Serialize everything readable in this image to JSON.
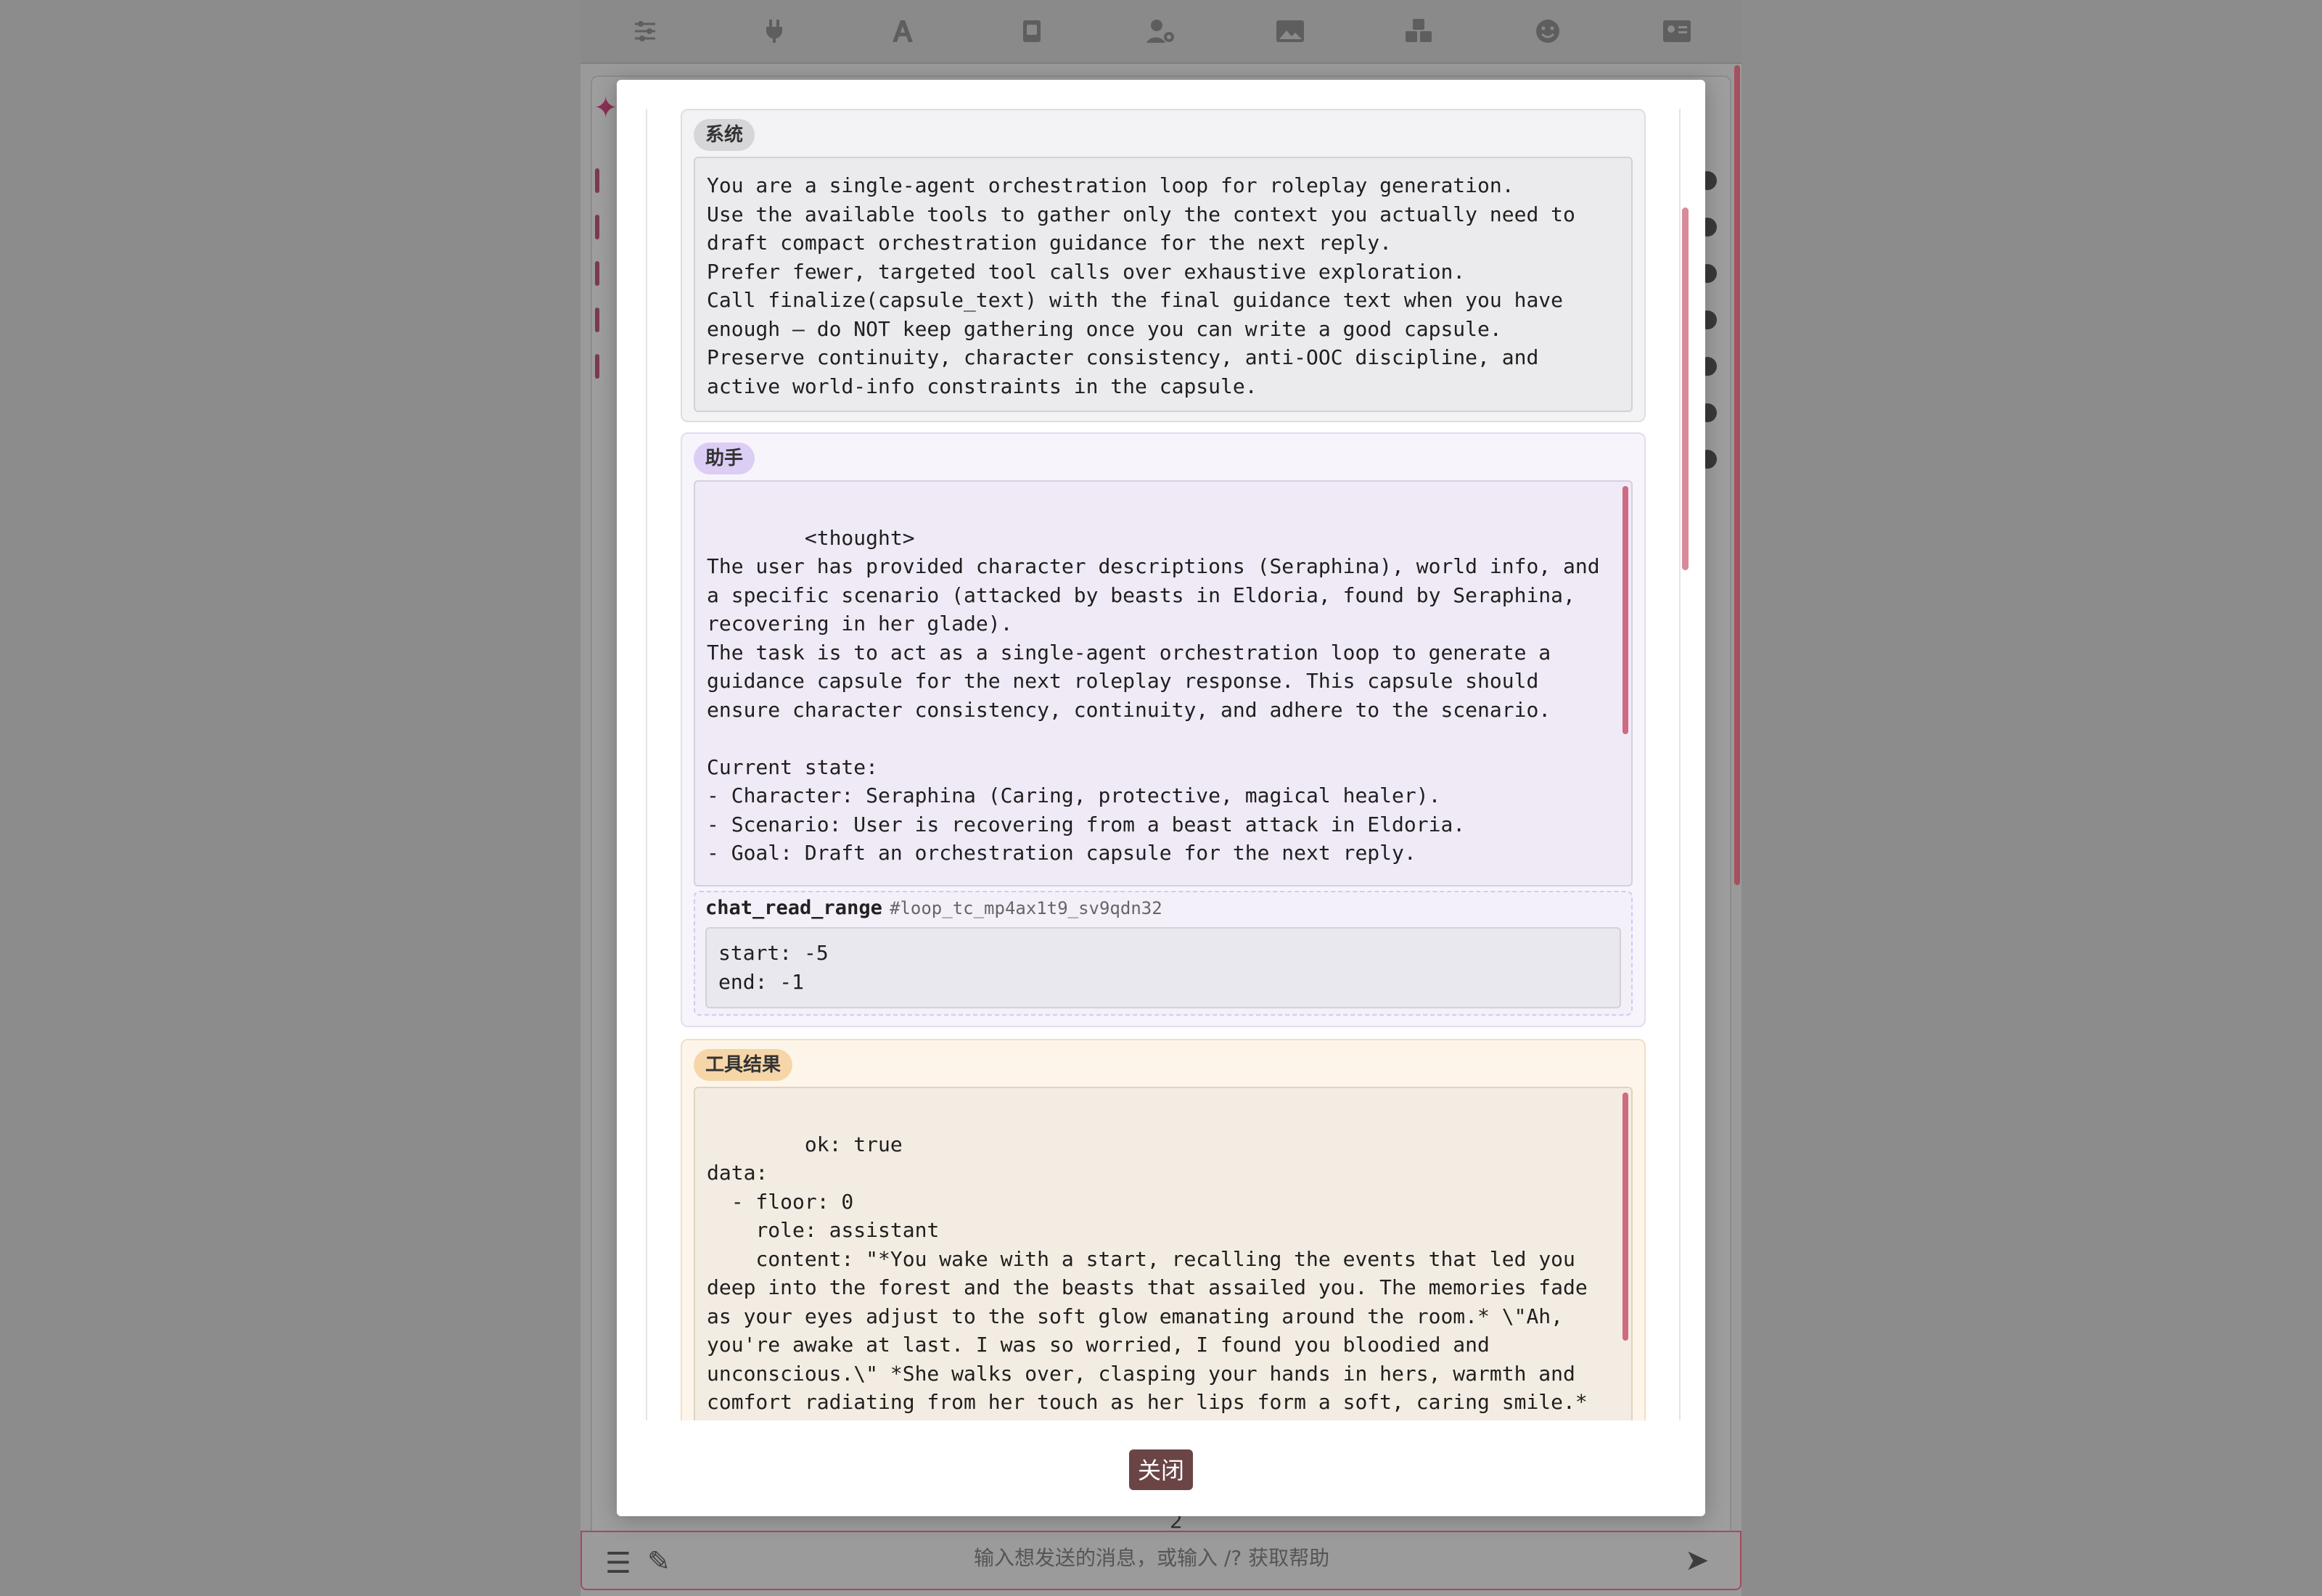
{
  "background": {
    "toolbar_icons": [
      "sliders-icon",
      "plug-icon",
      "font-icon",
      "book-icon",
      "user-gear-icon",
      "image-icon",
      "cubes-icon",
      "smile-icon",
      "id-card-icon"
    ],
    "input_placeholder": "输入想发送的消息，或输入 /? 获取帮助",
    "page_number": "2"
  },
  "modal": {
    "messages": {
      "system": {
        "role_label": "系统",
        "content": "You are a single-agent orchestration loop for roleplay generation.\nUse the available tools to gather only the context you actually need to draft compact orchestration guidance for the next reply.\nPrefer fewer, targeted tool calls over exhaustive exploration.\nCall finalize(capsule_text) with the final guidance text when you have enough — do NOT keep gathering once you can write a good capsule.\nPreserve continuity, character consistency, anti-OOC discipline, and active world-info constraints in the capsule."
      },
      "assistant": {
        "role_label": "助手",
        "content": "<thought>\nThe user has provided character descriptions (Seraphina), world info, and a specific scenario (attacked by beasts in Eldoria, found by Seraphina, recovering in her glade).\nThe task is to act as a single-agent orchestration loop to generate a guidance capsule for the next roleplay response. This capsule should ensure character consistency, continuity, and adhere to the scenario.\n\nCurrent state:\n- Character: Seraphina (Caring, protective, magical healer).\n- Scenario: User is recovering from a beast attack in Eldoria.\n- Goal: Draft an orchestration capsule for the next reply.\n\nI need to see the actual conversation history (if any) or any specific",
        "tool_call": {
          "name": "chat_read_range",
          "id": "#loop_tc_mp4ax1t9_sv9qdn32",
          "args": "start: -5\nend: -1"
        }
      },
      "tool_result": {
        "role_label": "工具结果",
        "content": "ok: true\ndata:\n  - floor: 0\n    role: assistant\n    content: \"*You wake with a start, recalling the events that led you deep into the forest and the beasts that assailed you. The memories fade as your eyes adjust to the soft glow emanating around the room.* \\\"Ah, you're awake at last. I was so worried, I found you bloodied and unconscious.\\\" *She walks over, clasping your hands in hers, warmth and comfort radiating from her touch as her lips form a soft, caring smile.* \\\"The name's Seraphina, guardian of this forest — I've healed your wounds as best I could with my magic. How are you feeling? I hope the tea helps"
      }
    },
    "close_label": "关闭"
  }
}
